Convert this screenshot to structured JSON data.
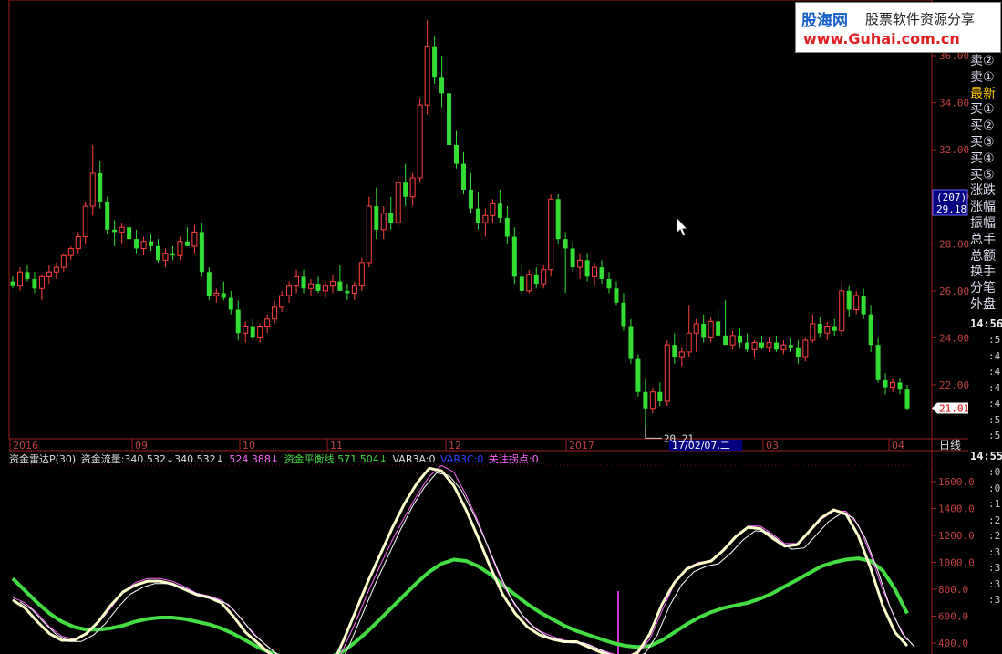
{
  "logo": {
    "brand": "股海网",
    "slogan": "股票软件资源分享",
    "url": "www.Guhai.com.cn"
  },
  "price_axis": {
    "ticks": [
      "36.00",
      "34.00",
      "32.00",
      "30.00",
      "28.00",
      "26.00",
      "24.00",
      "22.00"
    ],
    "current_count": "(207)",
    "current_cursor": "29.18",
    "last_price": "21.01",
    "low_label": "20.21"
  },
  "time_axis": {
    "labels": [
      "2016",
      "09",
      "10",
      "11",
      "12",
      "2017",
      "03",
      "04"
    ],
    "cursor": "17/02/07,二",
    "period": "日线"
  },
  "indicator": {
    "name": "资金雷达P(30)",
    "flow": "资金流量:340.532↓340.532↓",
    "v2": "524.388↓",
    "balance": "资金平衡线:571.504↓",
    "var3a": "VAR3A:0",
    "var3c": "VAR3C:0",
    "focus": "关注拐点:0",
    "ticks": [
      "1600.0",
      "1400.0",
      "1200.0",
      "1000.0",
      "800.0",
      "600.0",
      "400.0"
    ]
  },
  "right_panel": {
    "items": [
      "卖②",
      "卖①",
      "最新",
      "买①",
      "买②",
      "买③",
      "买④",
      "买⑤",
      "涨跌",
      "涨幅",
      "振幅",
      "总手",
      "总额",
      "换手",
      "分笔",
      "外盘"
    ],
    "time1": "14:56",
    "time2": "14:55",
    "col1": [
      ":5",
      ":4",
      ":4",
      ":4",
      ":4",
      ":5",
      ":5"
    ],
    "col2": [
      ":0",
      ":0",
      ":1",
      ":2",
      ":2",
      ":3",
      ":3",
      ":3",
      ":3"
    ]
  },
  "chart_data": {
    "type": "candlestick",
    "ylim": [
      19.5,
      37
    ],
    "colors": {
      "up": "#ff4040",
      "down": "#33dd33"
    },
    "candles": [
      [
        26.4,
        26.6,
        26.1,
        26.2
      ],
      [
        26.2,
        27.0,
        26.0,
        26.8
      ],
      [
        26.8,
        27.1,
        26.4,
        26.5
      ],
      [
        26.5,
        26.8,
        25.9,
        26.1
      ],
      [
        26.1,
        26.7,
        25.6,
        26.6
      ],
      [
        26.6,
        27.1,
        26.3,
        26.8
      ],
      [
        26.8,
        27.2,
        26.5,
        27.0
      ],
      [
        27.0,
        27.6,
        26.8,
        27.5
      ],
      [
        27.5,
        27.9,
        27.3,
        27.8
      ],
      [
        27.8,
        28.5,
        27.6,
        28.3
      ],
      [
        28.3,
        29.8,
        28.0,
        29.6
      ],
      [
        29.6,
        32.2,
        29.2,
        31.0
      ],
      [
        31.0,
        31.5,
        29.5,
        29.8
      ],
      [
        29.8,
        30.0,
        28.4,
        28.6
      ],
      [
        28.6,
        29.0,
        27.9,
        28.5
      ],
      [
        28.5,
        28.9,
        28.0,
        28.7
      ],
      [
        28.7,
        29.1,
        28.1,
        28.2
      ],
      [
        28.2,
        28.6,
        27.6,
        27.8
      ],
      [
        27.8,
        28.3,
        27.5,
        28.1
      ],
      [
        28.1,
        28.4,
        27.7,
        27.9
      ],
      [
        27.9,
        28.2,
        27.2,
        27.3
      ],
      [
        27.3,
        27.8,
        27.0,
        27.6
      ],
      [
        27.6,
        27.9,
        27.3,
        27.5
      ],
      [
        27.5,
        28.3,
        27.3,
        28.1
      ],
      [
        28.1,
        28.7,
        27.9,
        27.9
      ],
      [
        27.9,
        28.8,
        27.6,
        28.5
      ],
      [
        28.5,
        28.9,
        26.6,
        26.8
      ],
      [
        26.8,
        27.0,
        25.6,
        25.8
      ],
      [
        25.8,
        26.1,
        25.5,
        25.9
      ],
      [
        25.9,
        26.4,
        25.6,
        25.7
      ],
      [
        25.7,
        26.0,
        25.0,
        25.2
      ],
      [
        25.2,
        25.6,
        23.9,
        24.2
      ],
      [
        24.2,
        24.7,
        23.8,
        24.5
      ],
      [
        24.5,
        24.8,
        23.9,
        24.0
      ],
      [
        24.0,
        24.6,
        23.8,
        24.5
      ],
      [
        24.5,
        25.0,
        24.2,
        24.8
      ],
      [
        24.8,
        25.6,
        24.6,
        25.3
      ],
      [
        25.3,
        26.0,
        25.1,
        25.8
      ],
      [
        25.8,
        26.4,
        25.5,
        26.2
      ],
      [
        26.2,
        26.9,
        25.9,
        26.6
      ],
      [
        26.6,
        26.9,
        25.9,
        26.1
      ],
      [
        26.1,
        26.5,
        25.8,
        26.3
      ],
      [
        26.3,
        26.6,
        25.9,
        26.0
      ],
      [
        26.0,
        26.4,
        25.7,
        26.2
      ],
      [
        26.2,
        26.7,
        25.9,
        26.4
      ],
      [
        26.4,
        27.1,
        26.1,
        26.0
      ],
      [
        26.0,
        26.3,
        25.6,
        25.9
      ],
      [
        25.9,
        26.4,
        25.6,
        26.2
      ],
      [
        26.2,
        27.4,
        26.0,
        27.2
      ],
      [
        27.2,
        30.0,
        27.0,
        29.6
      ],
      [
        29.6,
        30.4,
        28.2,
        28.6
      ],
      [
        28.6,
        29.6,
        28.2,
        29.3
      ],
      [
        29.3,
        30.0,
        28.6,
        28.9
      ],
      [
        28.9,
        30.9,
        28.7,
        30.6
      ],
      [
        30.6,
        31.4,
        29.6,
        30.0
      ],
      [
        30.0,
        31.0,
        29.6,
        30.8
      ],
      [
        30.8,
        34.2,
        30.6,
        33.9
      ],
      [
        33.9,
        37.5,
        33.5,
        36.4
      ],
      [
        36.4,
        36.8,
        34.8,
        35.1
      ],
      [
        35.1,
        36.0,
        33.8,
        34.4
      ],
      [
        34.4,
        34.8,
        32.1,
        32.2
      ],
      [
        32.2,
        32.8,
        31.2,
        31.4
      ],
      [
        31.4,
        31.9,
        30.1,
        30.3
      ],
      [
        30.3,
        31.0,
        29.3,
        29.5
      ],
      [
        29.5,
        30.2,
        28.6,
        28.9
      ],
      [
        28.9,
        29.5,
        28.3,
        29.2
      ],
      [
        29.2,
        29.9,
        28.9,
        29.7
      ],
      [
        29.7,
        30.3,
        28.9,
        29.1
      ],
      [
        29.1,
        29.6,
        28.0,
        28.3
      ],
      [
        28.3,
        28.7,
        26.3,
        26.6
      ],
      [
        26.6,
        27.2,
        25.8,
        26.0
      ],
      [
        26.0,
        26.9,
        25.9,
        26.7
      ],
      [
        26.7,
        27.0,
        26.1,
        26.3
      ],
      [
        26.3,
        27.1,
        26.1,
        26.9
      ],
      [
        26.9,
        30.1,
        26.6,
        29.9
      ],
      [
        29.9,
        30.1,
        28.0,
        28.2
      ],
      [
        28.2,
        28.5,
        25.9,
        27.8
      ],
      [
        27.8,
        28.1,
        26.8,
        27.0
      ],
      [
        27.0,
        27.6,
        26.5,
        27.3
      ],
      [
        27.3,
        27.6,
        26.4,
        26.6
      ],
      [
        26.6,
        27.2,
        26.2,
        27.0
      ],
      [
        27.0,
        27.3,
        26.3,
        26.5
      ],
      [
        26.5,
        26.8,
        25.9,
        26.1
      ],
      [
        26.1,
        26.4,
        25.4,
        25.5
      ],
      [
        25.5,
        25.9,
        24.3,
        24.5
      ],
      [
        24.5,
        24.8,
        22.9,
        23.1
      ],
      [
        23.1,
        23.3,
        21.5,
        21.7
      ],
      [
        21.7,
        22.3,
        20.2,
        21.0
      ],
      [
        21.0,
        21.9,
        20.8,
        21.7
      ],
      [
        21.7,
        22.1,
        21.1,
        21.3
      ],
      [
        21.3,
        23.9,
        21.1,
        23.7
      ],
      [
        23.7,
        24.2,
        22.9,
        23.2
      ],
      [
        23.2,
        23.6,
        22.8,
        23.4
      ],
      [
        23.4,
        25.4,
        23.2,
        24.2
      ],
      [
        24.2,
        24.8,
        23.4,
        24.6
      ],
      [
        24.6,
        25.0,
        23.8,
        24.0
      ],
      [
        24.0,
        24.9,
        23.8,
        24.7
      ],
      [
        24.7,
        25.2,
        24.0,
        24.1
      ],
      [
        24.1,
        25.6,
        23.9,
        23.7
      ],
      [
        23.7,
        24.3,
        23.5,
        24.1
      ],
      [
        24.1,
        24.4,
        23.6,
        23.8
      ],
      [
        23.8,
        24.2,
        23.4,
        23.5
      ],
      [
        23.5,
        23.9,
        23.2,
        23.8
      ],
      [
        23.8,
        24.1,
        23.5,
        23.6
      ],
      [
        23.6,
        24.0,
        23.4,
        23.8
      ],
      [
        23.8,
        24.1,
        23.4,
        23.5
      ],
      [
        23.5,
        23.9,
        23.3,
        23.7
      ],
      [
        23.7,
        24.0,
        23.4,
        23.6
      ],
      [
        23.6,
        23.9,
        22.9,
        23.2
      ],
      [
        23.2,
        24.0,
        23.0,
        23.9
      ],
      [
        23.9,
        25.0,
        23.8,
        24.6
      ],
      [
        24.6,
        24.9,
        24.0,
        24.2
      ],
      [
        24.2,
        24.7,
        23.9,
        24.5
      ],
      [
        24.5,
        24.8,
        24.1,
        24.3
      ],
      [
        24.3,
        26.4,
        24.1,
        26.0
      ],
      [
        26.0,
        26.2,
        24.9,
        25.2
      ],
      [
        25.2,
        26.0,
        25.0,
        25.8
      ],
      [
        25.8,
        26.1,
        24.8,
        25.0
      ],
      [
        25.0,
        25.4,
        23.4,
        23.7
      ],
      [
        23.7,
        24.0,
        22.1,
        22.2
      ],
      [
        22.2,
        22.5,
        21.6,
        21.9
      ],
      [
        21.9,
        22.3,
        21.7,
        22.1
      ],
      [
        22.1,
        22.3,
        21.6,
        21.8
      ],
      [
        21.8,
        22.0,
        20.9,
        21.0
      ]
    ],
    "indicator_series": [
      {
        "name": "资金流量",
        "color": "#ffffcc",
        "width": 3,
        "values": [
          720,
          660,
          560,
          470,
          420,
          420,
          470,
          560,
          680,
          780,
          830,
          860,
          860,
          840,
          800,
          760,
          740,
          700,
          600,
          480,
          400,
          320,
          250,
          200,
          170,
          170,
          220,
          420,
          640,
          860,
          1060,
          1260,
          1440,
          1590,
          1700,
          1680,
          1570,
          1390,
          1180,
          960,
          760,
          620,
          520,
          460,
          430,
          410,
          410,
          370,
          330,
          300,
          290,
          330,
          470,
          690,
          850,
          950,
          990,
          1010,
          1090,
          1190,
          1260,
          1250,
          1180,
          1120,
          1130,
          1230,
          1330,
          1390,
          1360,
          1200,
          960,
          680,
          480,
          380
        ]
      },
      {
        "name": "V2",
        "color": "#ff66ff",
        "width": 1,
        "values": [
          740,
          700,
          620,
          520,
          450,
          430,
          470,
          550,
          660,
          780,
          850,
          880,
          880,
          860,
          820,
          770,
          750,
          720,
          650,
          540,
          440,
          360,
          290,
          230,
          190,
          180,
          200,
          360,
          560,
          780,
          980,
          1170,
          1340,
          1500,
          1640,
          1720,
          1670,
          1500,
          1300,
          1060,
          840,
          680,
          560,
          490,
          450,
          420,
          410,
          390,
          350,
          320,
          300,
          320,
          430,
          640,
          840,
          960,
          1000,
          1010,
          1080,
          1180,
          1270,
          1270,
          1210,
          1140,
          1140,
          1220,
          1320,
          1380,
          1380,
          1280,
          1060,
          800,
          580,
          420
        ]
      },
      {
        "name": "资金平衡线",
        "color": "#44dd44",
        "width": 4,
        "values": [
          880,
          790,
          700,
          620,
          560,
          520,
          500,
          500,
          510,
          530,
          560,
          580,
          590,
          590,
          580,
          560,
          540,
          510,
          470,
          420,
          370,
          330,
          300,
          280,
          270,
          280,
          300,
          340,
          410,
          490,
          580,
          670,
          760,
          850,
          930,
          990,
          1020,
          1010,
          970,
          910,
          830,
          760,
          690,
          630,
          580,
          530,
          490,
          460,
          430,
          400,
          380,
          370,
          380,
          420,
          480,
          540,
          590,
          630,
          660,
          680,
          700,
          730,
          770,
          820,
          870,
          920,
          970,
          1000,
          1020,
          1030,
          1010,
          940,
          800,
          620
        ]
      }
    ],
    "indicator_ylim": [
      380,
      1800
    ]
  }
}
